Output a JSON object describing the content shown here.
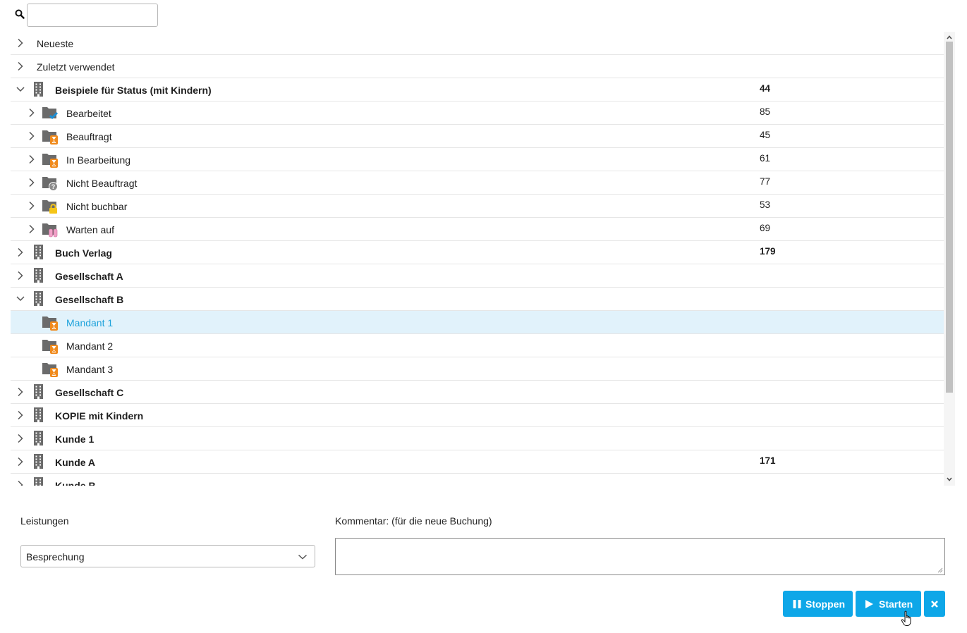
{
  "search": {
    "value": "",
    "placeholder": ""
  },
  "tree": [
    {
      "label": "Neueste",
      "level": 0,
      "plain": true,
      "expanded": false,
      "icon": "none",
      "count": ""
    },
    {
      "label": "Zuletzt verwendet",
      "level": 0,
      "plain": true,
      "expanded": false,
      "icon": "none",
      "count": ""
    },
    {
      "label": "Beispiele für Status (mit Kindern)",
      "level": 0,
      "expanded": true,
      "icon": "building",
      "count": "44"
    },
    {
      "label": "Bearbeitet",
      "level": 1,
      "expanded": false,
      "hasChildren": true,
      "icon": "folder-check",
      "count": "85"
    },
    {
      "label": "Beauftragt",
      "level": 1,
      "expanded": false,
      "hasChildren": true,
      "icon": "folder-hourglass",
      "count": "45"
    },
    {
      "label": "In Bearbeitung",
      "level": 1,
      "expanded": false,
      "hasChildren": true,
      "icon": "folder-hourglass",
      "count": "61"
    },
    {
      "label": "Nicht Beauftragt",
      "level": 1,
      "expanded": false,
      "hasChildren": true,
      "icon": "folder-question",
      "count": "77"
    },
    {
      "label": "Nicht buchbar",
      "level": 1,
      "expanded": false,
      "hasChildren": true,
      "icon": "folder-lock",
      "count": "53"
    },
    {
      "label": "Warten auf",
      "level": 1,
      "expanded": false,
      "hasChildren": true,
      "icon": "folder-pause",
      "count": "69"
    },
    {
      "label": "Buch Verlag",
      "level": 0,
      "expanded": false,
      "icon": "building",
      "count": "179"
    },
    {
      "label": "Gesellschaft A",
      "level": 0,
      "expanded": false,
      "icon": "building",
      "count": ""
    },
    {
      "label": "Gesellschaft B",
      "level": 0,
      "expanded": true,
      "icon": "building",
      "count": ""
    },
    {
      "label": "Mandant 1",
      "level": 1,
      "hasChildren": false,
      "selected": true,
      "icon": "folder-hourglass",
      "count": ""
    },
    {
      "label": "Mandant 2",
      "level": 1,
      "hasChildren": false,
      "icon": "folder-hourglass",
      "count": ""
    },
    {
      "label": "Mandant 3",
      "level": 1,
      "hasChildren": false,
      "icon": "folder-hourglass",
      "count": ""
    },
    {
      "label": "Gesellschaft C",
      "level": 0,
      "expanded": false,
      "icon": "building",
      "count": ""
    },
    {
      "label": "KOPIE mit Kindern",
      "level": 0,
      "expanded": false,
      "icon": "building",
      "count": ""
    },
    {
      "label": "Kunde 1",
      "level": 0,
      "expanded": false,
      "icon": "building",
      "count": ""
    },
    {
      "label": "Kunde A",
      "level": 0,
      "expanded": false,
      "icon": "building",
      "count": "171"
    },
    {
      "label": "Kunde B",
      "level": 0,
      "expanded": false,
      "icon": "building",
      "count": ""
    }
  ],
  "form": {
    "services_label": "Leistungen",
    "services_value": "Besprechung",
    "comment_label": "Kommentar: (für die neue Buchung)",
    "comment_value": ""
  },
  "buttons": {
    "stop": "Stoppen",
    "start": "Starten",
    "close_icon": "close-icon"
  },
  "colors": {
    "accent": "#0ea7e8",
    "selected_bg": "#e1f2fb",
    "selected_text": "#1fa3db",
    "folder_gray": "#6b6b6b",
    "hourglass_orange": "#f08a1c",
    "check_blue": "#1b8fd6",
    "lock_yellow": "#f5c518",
    "pause_pink": "#f2a1c8"
  }
}
